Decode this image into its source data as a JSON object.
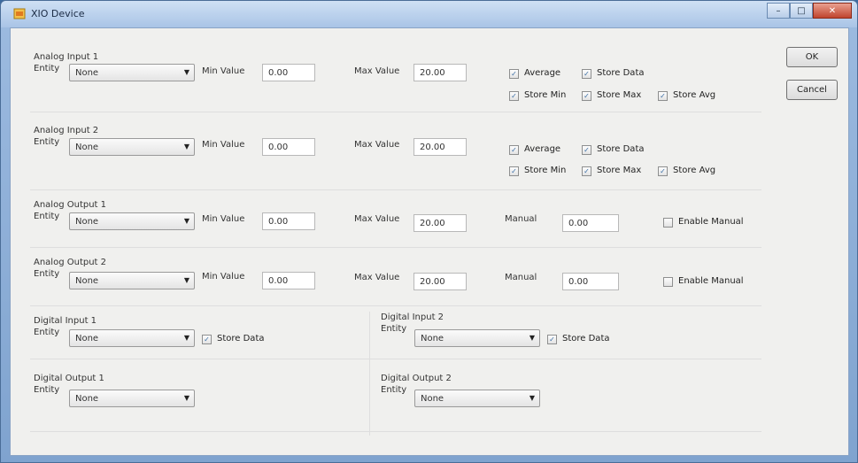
{
  "window": {
    "title": "XIO Device"
  },
  "buttons": {
    "ok": "OK",
    "cancel": "Cancel"
  },
  "common": {
    "entity_label": "Entity",
    "min_label": "Min Value",
    "max_label": "Max Value",
    "manual_label": "Manual"
  },
  "analog_input_1": {
    "title": "Analog Input 1",
    "entity": "None",
    "min": "0.00",
    "max": "20.00",
    "average": "Average",
    "store_data": "Store Data",
    "store_min": "Store Min",
    "store_max": "Store Max",
    "store_avg": "Store Avg"
  },
  "analog_input_2": {
    "title": "Analog Input 2",
    "entity": "None",
    "min": "0.00",
    "max": "20.00",
    "average": "Average",
    "store_data": "Store Data",
    "store_min": "Store Min",
    "store_max": "Store Max",
    "store_avg": "Store Avg"
  },
  "analog_output_1": {
    "title": "Analog Output 1",
    "entity": "None",
    "min": "0.00",
    "max": "20.00",
    "manual": "0.00",
    "enable_manual": "Enable Manual"
  },
  "analog_output_2": {
    "title": "Analog Output 2",
    "entity": "None",
    "min": "0.00",
    "max": "20.00",
    "manual": "0.00",
    "enable_manual": "Enable Manual"
  },
  "digital_input_1": {
    "title": "Digital Input 1",
    "entity": "None",
    "store_data": "Store Data"
  },
  "digital_input_2": {
    "title": "Digital Input 2",
    "entity": "None",
    "store_data": "Store Data"
  },
  "digital_output_1": {
    "title": "Digital Output 1",
    "entity": "None"
  },
  "digital_output_2": {
    "title": "Digital Output 2",
    "entity": "None"
  },
  "check_glyph": "✓",
  "arrow_glyph": "▼"
}
